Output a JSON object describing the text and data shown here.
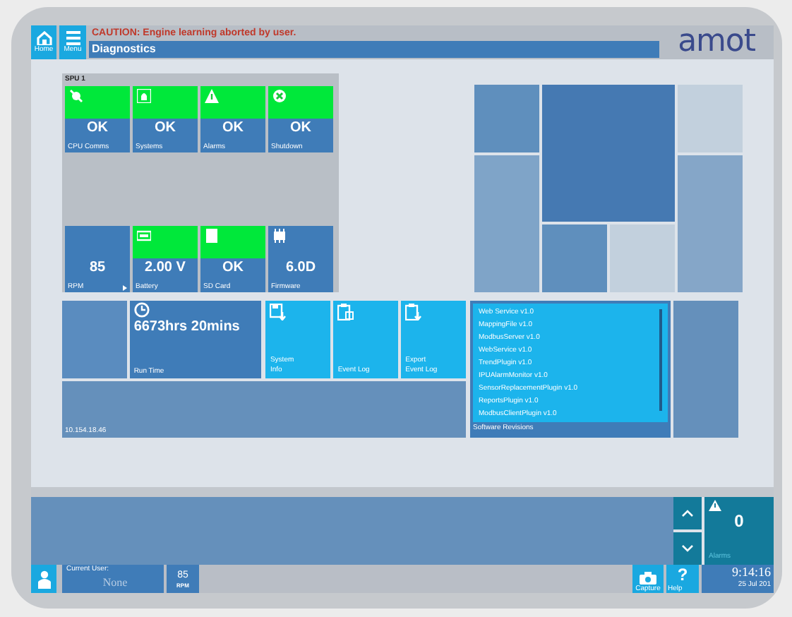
{
  "header": {
    "home_label": "Home",
    "menu_label": "Menu",
    "caution": "CAUTION: Engine learning aborted by user.",
    "title": "Diagnostics",
    "logo": "amot"
  },
  "spu_panel": {
    "title": "SPU 1",
    "top_tiles": [
      {
        "kind": "status",
        "value": "OK",
        "label": "CPU Comms",
        "healthy": true
      },
      {
        "kind": "status",
        "value": "OK",
        "label": "Systems",
        "healthy": true
      },
      {
        "kind": "status",
        "value": "OK",
        "label": "Alarms",
        "healthy": true
      },
      {
        "kind": "status",
        "value": "OK",
        "label": "Shutdown",
        "healthy": true
      }
    ],
    "bottom_tiles": [
      {
        "kind": "value",
        "value": "85",
        "label": "RPM"
      },
      {
        "kind": "status",
        "value": "2.00 V",
        "label": "Battery",
        "healthy": true
      },
      {
        "kind": "status",
        "value": "OK",
        "label": "SD Card",
        "healthy": true
      },
      {
        "kind": "value",
        "value": "6.0D",
        "label": "Firmware"
      }
    ]
  },
  "run_time": {
    "value": "6673hrs 20mins",
    "label": "Run Time"
  },
  "actions": [
    {
      "label": "System Info"
    },
    {
      "label": "Event Log"
    },
    {
      "label": "Export Event Log"
    }
  ],
  "ip_address": "10.154.18.46",
  "software": {
    "title": "Software Revisions",
    "items": [
      "Web Service v1.0",
      "MappingFile v1.0",
      "ModbusServer v1.0",
      "WebService v1.0",
      "TrendPlugin v1.0",
      "IPUAlarmMonitor v1.0",
      "SensorReplacementPlugin v1.0",
      "ReportsPlugin v1.0",
      "ModbusClientPlugin v1.0"
    ]
  },
  "alarms": {
    "count": "0",
    "label": "Alarms"
  },
  "status_bar": {
    "user_label": "Current User:",
    "user": "None",
    "rpm": "85",
    "rpm_label": "RPM",
    "capture_label": "Capture",
    "help": "?",
    "help_label": "Help",
    "time": "9:14:16",
    "date": "25 Jul 201"
  }
}
